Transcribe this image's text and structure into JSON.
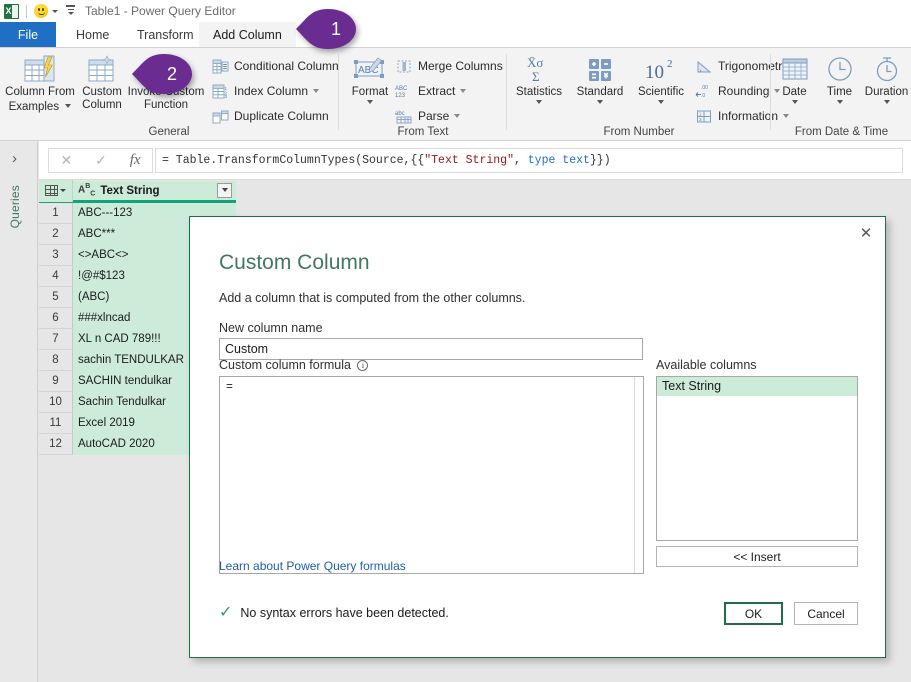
{
  "window": {
    "title": "Table1 - Power Query Editor",
    "app_icon": "excel-icon",
    "feedback_icon": "smiley-icon",
    "qat_dropdown_icon": "chevron-down-icon",
    "qat_customize_icon": "customize-quick-access-toolbar-icon"
  },
  "tabs": [
    {
      "label": "File",
      "id": "file"
    },
    {
      "label": "Home",
      "id": "home"
    },
    {
      "label": "Transform",
      "id": "transform"
    },
    {
      "label": "Add Column",
      "id": "add-column"
    }
  ],
  "ribbon": {
    "groups": [
      {
        "id": "general",
        "label": "General",
        "big_buttons": [
          {
            "label_line1": "Column From",
            "label_line2": "Examples",
            "has_arrow": true,
            "icon": "column-from-examples-icon"
          },
          {
            "label_line1": "Custom",
            "label_line2": "Column",
            "has_arrow": false,
            "icon": "custom-column-icon"
          },
          {
            "label_line1": "Invoke Custom",
            "label_line2": "Function",
            "has_arrow": false,
            "icon": "invoke-custom-function-icon"
          }
        ],
        "small_buttons": [
          {
            "label": "Conditional Column",
            "dropdown": false,
            "icon": "conditional-column-icon"
          },
          {
            "label": "Index Column",
            "dropdown": true,
            "icon": "index-column-icon"
          },
          {
            "label": "Duplicate Column",
            "dropdown": false,
            "icon": "duplicate-column-icon"
          }
        ]
      },
      {
        "id": "from-text",
        "label": "From Text",
        "big_buttons": [
          {
            "label_line1": "Format",
            "label_line2": "",
            "has_arrow": true,
            "icon": "format-icon"
          }
        ],
        "small_buttons": [
          {
            "label": "Merge Columns",
            "dropdown": false,
            "icon": "merge-columns-icon"
          },
          {
            "label": "Extract",
            "dropdown": true,
            "icon": "extract-icon"
          },
          {
            "label": "Parse",
            "dropdown": true,
            "icon": "parse-icon"
          }
        ]
      },
      {
        "id": "from-number",
        "label": "From Number",
        "big_buttons": [
          {
            "label_line1": "Statistics",
            "label_line2": "",
            "has_arrow": true,
            "icon": "statistics-icon"
          },
          {
            "label_line1": "Standard",
            "label_line2": "",
            "has_arrow": true,
            "icon": "standard-icon"
          },
          {
            "label_line1": "Scientific",
            "label_line2": "",
            "has_arrow": true,
            "icon": "scientific-icon"
          }
        ],
        "small_buttons": [
          {
            "label": "Trigonometry",
            "dropdown": true,
            "icon": "trigonometry-icon"
          },
          {
            "label": "Rounding",
            "dropdown": true,
            "icon": "rounding-icon"
          },
          {
            "label": "Information",
            "dropdown": true,
            "icon": "information-icon"
          }
        ]
      },
      {
        "id": "from-date-time",
        "label": "From Date & Time",
        "big_buttons": [
          {
            "label_line1": "Date",
            "label_line2": "",
            "has_arrow": true,
            "icon": "date-icon"
          },
          {
            "label_line1": "Time",
            "label_line2": "",
            "has_arrow": true,
            "icon": "time-icon"
          },
          {
            "label_line1": "Duration",
            "label_line2": "",
            "has_arrow": true,
            "icon": "duration-icon"
          }
        ],
        "small_buttons": []
      }
    ]
  },
  "queries_pane": {
    "label": "Queries",
    "expand_icon": "chevron-right-icon"
  },
  "formula_bar": {
    "cancel_icon": "close-icon",
    "accept_icon": "check-icon",
    "fx_icon": "fx-icon",
    "formula_prefix": "= Table.TransformColumnTypes(Source,{{",
    "formula_string": "\"Text String\"",
    "formula_mid": ", ",
    "formula_keyword": "type text",
    "formula_suffix": "}})"
  },
  "grid": {
    "column_header": "Text String",
    "column_type_icon": "abc-text-type-icon",
    "filter_icon": "filter-dropdown-icon",
    "table_icon": "select-all-table-icon",
    "rows": [
      {
        "num": "1",
        "value": "ABC---123"
      },
      {
        "num": "2",
        "value": "ABC***"
      },
      {
        "num": "3",
        "value": "<>ABC<>"
      },
      {
        "num": "4",
        "value": "!@#$123"
      },
      {
        "num": "5",
        "value": "(ABC)"
      },
      {
        "num": "6",
        "value": "###xlncad"
      },
      {
        "num": "7",
        "value": "XL n CAD 789!!!"
      },
      {
        "num": "8",
        "value": "sachin TENDULKAR"
      },
      {
        "num": "9",
        "value": "SACHIN tendulkar"
      },
      {
        "num": "10",
        "value": "Sachin Tendulkar"
      },
      {
        "num": "11",
        "value": "Excel 2019"
      },
      {
        "num": "12",
        "value": "AutoCAD 2020"
      }
    ]
  },
  "dialog": {
    "title": "Custom Column",
    "subtitle": "Add a column that is computed from the other columns.",
    "close_icon": "close-icon",
    "new_column_label": "New column name",
    "new_column_value": "Custom",
    "new_column_placeholder": "Custom",
    "formula_label": "Custom column formula",
    "formula_info_icon": "info-icon",
    "formula_value": "=",
    "available_label": "Available columns",
    "available_columns": [
      "Text String"
    ],
    "insert_button": "<< Insert",
    "learn_link": "Learn about Power Query formulas",
    "status_icon": "check-icon",
    "status_text": "No syntax errors have been detected.",
    "ok_button": "OK",
    "cancel_button": "Cancel"
  },
  "callouts": [
    {
      "number": "1",
      "target": "add-column-tab"
    },
    {
      "number": "2",
      "target": "custom-column-button"
    }
  ],
  "colors": {
    "excel_green": "#217346",
    "dialog_border": "#1d7045",
    "file_tab_blue": "#1f6fc4",
    "grid_green": "#cdebd9",
    "header_underline": "#12a37c",
    "callout_purple": "#6b2c91",
    "link_blue": "#1d5fa8",
    "title_text": "#3f7a5e"
  }
}
